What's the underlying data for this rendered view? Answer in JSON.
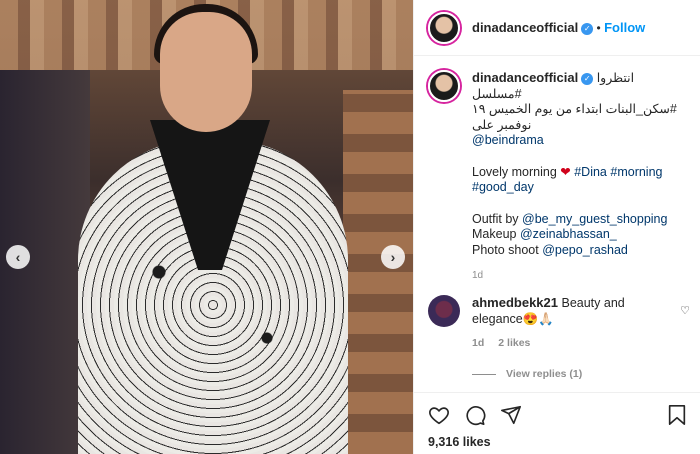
{
  "post": {
    "username": "dinadanceofficial",
    "verified_mark": "✓",
    "dot": "•",
    "follow_label": "Follow"
  },
  "caption": {
    "line1": "انتظروا #مسلسل",
    "line2": "#سكن_البنات ابتداء من يوم الخميس ١٩",
    "line3": "نوفمبر على",
    "mention1": "@beindrama",
    "lovely": "Lovely morning",
    "heart": "❤",
    "tag_dina": "#Dina",
    "tag_morning": "#morning",
    "tag_goodday": "#good_day",
    "outfit_label": "Outfit by",
    "outfit_handle": "@be_my_guest_shopping",
    "makeup_label": "Makeup",
    "makeup_handle": "@zeinabhassan_",
    "photo_label": "Photo shoot",
    "photo_handle": "@pepo_rashad",
    "time": "1d"
  },
  "comment": {
    "username": "ahmedbekk21",
    "text": "Beauty and elegance😍🙏🏻",
    "time": "1d",
    "likes": "2 likes",
    "view_replies": "View replies (1)"
  },
  "actions": {
    "likes_count": "9,316 likes"
  },
  "icons": {
    "prev": "prev-arrow-icon",
    "next": "next-arrow-icon",
    "heart": "heart-icon",
    "comment": "comment-icon",
    "share": "share-icon",
    "bookmark": "bookmark-icon"
  },
  "colors": {
    "accent": "#0095f6",
    "verified": "#3897f0",
    "link": "#00376b",
    "muted": "#8e8e8e"
  }
}
